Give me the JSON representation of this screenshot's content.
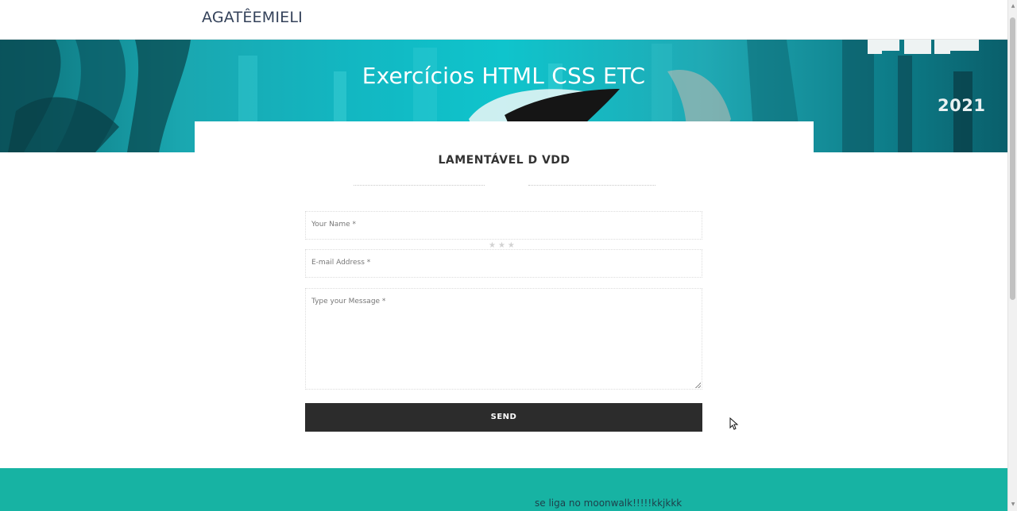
{
  "navbar": {
    "brand": "AGATÊEMIELI"
  },
  "hero": {
    "title": "Exercícios HTML CSS ETC",
    "badge_year": "2021"
  },
  "contact": {
    "heading": "LAMENTÁVEL D VDD",
    "divider_stars": "★★★",
    "name_placeholder": "Your Name *",
    "email_placeholder": "E-mail Address *",
    "message_placeholder": "Type your Message *",
    "send_label": "SEND"
  },
  "footer": {
    "text": "se liga no moonwalk!!!!!kkjkkk"
  },
  "colors": {
    "brand_text": "#34425a",
    "hero_teal": "#12b7c2",
    "button_bg": "#2c2c2c",
    "footer_bg": "#17b3a3"
  },
  "icons": {
    "cursor": "mouse-pointer-icon",
    "resize": "resize-grip-icon"
  }
}
